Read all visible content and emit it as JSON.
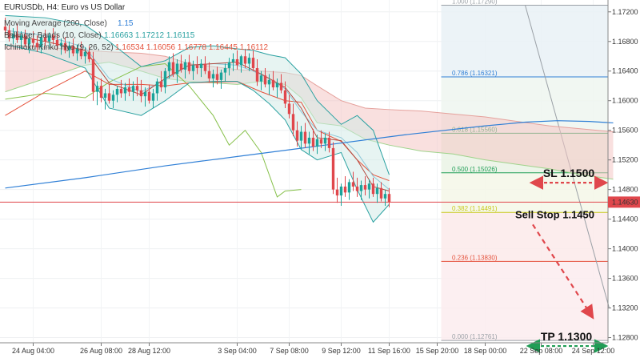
{
  "chart_data": {
    "type": "candlestick",
    "title": "EURUSDb, H4: Euro vs US Dollar",
    "indicators": [
      {
        "label": "Moving Average (200, Close)",
        "values": "1.15",
        "color": "#2f7fd6"
      },
      {
        "label": "Bollinger Bands (10, Close)",
        "values": "1.16663  1.17212  1.16115",
        "color": "#2aa1a1"
      },
      {
        "label": "Ichimoku Kinko Hyo (9, 26, 52)",
        "values": "1.16534  1.16056  1.16778  1.16445  1.16112",
        "color": "#e5533d"
      }
    ],
    "x_tick_labels": [
      "24 Aug 04:00",
      "26 Aug 08:00",
      "28 Aug 12:00",
      "3 Sep 04:00",
      "7 Sep 08:00",
      "9 Sep 12:00",
      "11 Sep 16:00",
      "15 Sep 20:00",
      "18 Sep 00:00",
      "22 Sep 08:00",
      "24 Sep 12:00"
    ],
    "y_tick_labels": [
      "1.17200",
      "1.16800",
      "1.16400",
      "1.16000",
      "1.15600",
      "1.15200",
      "1.14800",
      "1.14400",
      "1.14000",
      "1.13600",
      "1.13200",
      "1.12800"
    ],
    "ylim": [
      1.1273,
      1.1736
    ],
    "current_price": "1.14630",
    "candles": [
      [
        1.17,
        1.1712,
        1.1688,
        1.1695
      ],
      [
        1.1695,
        1.1702,
        1.168,
        1.1684
      ],
      [
        1.1684,
        1.1698,
        1.1676,
        1.169
      ],
      [
        1.169,
        1.1704,
        1.1678,
        1.1682
      ],
      [
        1.1682,
        1.1694,
        1.167,
        1.1688
      ],
      [
        1.1688,
        1.1696,
        1.1672,
        1.1676
      ],
      [
        1.1676,
        1.169,
        1.1664,
        1.1684
      ],
      [
        1.1684,
        1.1694,
        1.1672,
        1.1678
      ],
      [
        1.1678,
        1.1688,
        1.1666,
        1.1672
      ],
      [
        1.1672,
        1.169,
        1.1664,
        1.1686
      ],
      [
        1.1686,
        1.1696,
        1.1674,
        1.168
      ],
      [
        1.168,
        1.1692,
        1.167,
        1.1688
      ],
      [
        1.1688,
        1.1698,
        1.1676,
        1.1682
      ],
      [
        1.1682,
        1.169,
        1.1668,
        1.1674
      ],
      [
        1.1674,
        1.1684,
        1.1662,
        1.1678
      ],
      [
        1.1678,
        1.1686,
        1.1664,
        1.1668
      ],
      [
        1.1668,
        1.168,
        1.1658,
        1.1674
      ],
      [
        1.1674,
        1.1684,
        1.166,
        1.1664
      ],
      [
        1.1664,
        1.1676,
        1.1654,
        1.167
      ],
      [
        1.167,
        1.168,
        1.1656,
        1.166
      ],
      [
        1.166,
        1.1672,
        1.165,
        1.1666
      ],
      [
        1.1666,
        1.1674,
        1.1652,
        1.1656
      ],
      [
        1.1656,
        1.1666,
        1.16,
        1.1612
      ],
      [
        1.1612,
        1.1626,
        1.1594,
        1.162
      ],
      [
        1.162,
        1.163,
        1.1598,
        1.1604
      ],
      [
        1.1604,
        1.1616,
        1.1588,
        1.161
      ],
      [
        1.161,
        1.1622,
        1.1596,
        1.16
      ],
      [
        1.16,
        1.1614,
        1.159,
        1.1608
      ],
      [
        1.1608,
        1.162,
        1.1598,
        1.1616
      ],
      [
        1.1616,
        1.1628,
        1.1604,
        1.161
      ],
      [
        1.161,
        1.1624,
        1.16,
        1.1618
      ],
      [
        1.1618,
        1.163,
        1.1606,
        1.1612
      ],
      [
        1.1612,
        1.1626,
        1.16,
        1.162
      ],
      [
        1.162,
        1.1632,
        1.1606,
        1.1614
      ],
      [
        1.1614,
        1.1628,
        1.1598,
        1.1606
      ],
      [
        1.1606,
        1.1618,
        1.1592,
        1.1612
      ],
      [
        1.1612,
        1.1622,
        1.1596,
        1.16
      ],
      [
        1.16,
        1.1616,
        1.159,
        1.161
      ],
      [
        1.161,
        1.163,
        1.16,
        1.1626
      ],
      [
        1.1626,
        1.164,
        1.1612,
        1.1618
      ],
      [
        1.1618,
        1.1644,
        1.161,
        1.164
      ],
      [
        1.164,
        1.166,
        1.163,
        1.1652
      ],
      [
        1.1652,
        1.1664,
        1.1632,
        1.1636
      ],
      [
        1.1636,
        1.1656,
        1.1624,
        1.165
      ],
      [
        1.165,
        1.1662,
        1.1638,
        1.1642
      ],
      [
        1.1642,
        1.1656,
        1.163,
        1.1652
      ],
      [
        1.1652,
        1.1662,
        1.1636,
        1.164
      ],
      [
        1.164,
        1.1654,
        1.1628,
        1.1648
      ],
      [
        1.1648,
        1.166,
        1.1636,
        1.1644
      ],
      [
        1.1644,
        1.1656,
        1.1632,
        1.165
      ],
      [
        1.165,
        1.166,
        1.1636,
        1.164
      ],
      [
        1.164,
        1.1652,
        1.1624,
        1.163
      ],
      [
        1.163,
        1.1642,
        1.1618,
        1.1636
      ],
      [
        1.1636,
        1.1646,
        1.1622,
        1.1628
      ],
      [
        1.1628,
        1.1642,
        1.1616,
        1.1638
      ],
      [
        1.1638,
        1.165,
        1.1626,
        1.1644
      ],
      [
        1.1644,
        1.1658,
        1.1634,
        1.1652
      ],
      [
        1.1652,
        1.1664,
        1.164,
        1.1656
      ],
      [
        1.1656,
        1.1668,
        1.1642,
        1.1648
      ],
      [
        1.1648,
        1.1662,
        1.1638,
        1.166
      ],
      [
        1.166,
        1.167,
        1.1644,
        1.165
      ],
      [
        1.165,
        1.1664,
        1.164,
        1.1658
      ],
      [
        1.1658,
        1.1668,
        1.164,
        1.1644
      ],
      [
        1.1644,
        1.1656,
        1.162,
        1.1626
      ],
      [
        1.1626,
        1.164,
        1.1614,
        1.1634
      ],
      [
        1.1634,
        1.1644,
        1.1618,
        1.1622
      ],
      [
        1.1622,
        1.1636,
        1.1608,
        1.1628
      ],
      [
        1.1628,
        1.164,
        1.1614,
        1.1618
      ],
      [
        1.1618,
        1.163,
        1.1604,
        1.1624
      ],
      [
        1.1624,
        1.1636,
        1.161,
        1.1614
      ],
      [
        1.1614,
        1.1626,
        1.159,
        1.1596
      ],
      [
        1.1596,
        1.1608,
        1.1576,
        1.1582
      ],
      [
        1.1582,
        1.1596,
        1.1552,
        1.156
      ],
      [
        1.156,
        1.1572,
        1.1538,
        1.1546
      ],
      [
        1.1546,
        1.1566,
        1.1534,
        1.1558
      ],
      [
        1.1558,
        1.157,
        1.1536,
        1.1542
      ],
      [
        1.1542,
        1.1558,
        1.1528,
        1.155
      ],
      [
        1.155,
        1.1562,
        1.1532,
        1.1538
      ],
      [
        1.1538,
        1.1554,
        1.1528,
        1.1548
      ],
      [
        1.1548,
        1.156,
        1.1536,
        1.1542
      ],
      [
        1.1542,
        1.1556,
        1.1532,
        1.155
      ],
      [
        1.155,
        1.1558,
        1.153,
        1.1536
      ],
      [
        1.1536,
        1.1544,
        1.1474,
        1.148
      ],
      [
        1.148,
        1.1496,
        1.1462,
        1.1472
      ],
      [
        1.1472,
        1.1488,
        1.1458,
        1.1484
      ],
      [
        1.1484,
        1.1498,
        1.147,
        1.1476
      ],
      [
        1.1476,
        1.1494,
        1.1466,
        1.149
      ],
      [
        1.149,
        1.1504,
        1.1478,
        1.1484
      ],
      [
        1.1484,
        1.1496,
        1.147,
        1.1478
      ],
      [
        1.1478,
        1.1492,
        1.1466,
        1.1486
      ],
      [
        1.1486,
        1.1498,
        1.1472,
        1.148
      ],
      [
        1.148,
        1.1494,
        1.1468,
        1.1488
      ],
      [
        1.1488,
        1.1496,
        1.147,
        1.1474
      ],
      [
        1.1474,
        1.1488,
        1.1462,
        1.1482
      ],
      [
        1.1482,
        1.149,
        1.1464,
        1.1468
      ],
      [
        1.1468,
        1.148,
        1.1458,
        1.1474
      ],
      [
        1.1474,
        1.1482,
        1.1456,
        1.1463
      ]
    ],
    "ma200": [
      [
        0,
        1.1482
      ],
      [
        20,
        1.1496
      ],
      [
        40,
        1.1512
      ],
      [
        60,
        1.1526
      ],
      [
        80,
        1.154
      ],
      [
        100,
        1.1554
      ],
      [
        120,
        1.1566
      ],
      [
        130,
        1.1571
      ],
      [
        138,
        1.1573
      ],
      [
        146,
        1.1572
      ],
      [
        152,
        1.157
      ]
    ],
    "bb_mid": [
      [
        0,
        1.1695
      ],
      [
        10,
        1.1688
      ],
      [
        20,
        1.1672
      ],
      [
        26,
        1.163
      ],
      [
        34,
        1.1612
      ],
      [
        40,
        1.1628
      ],
      [
        46,
        1.1648
      ],
      [
        52,
        1.165
      ],
      [
        58,
        1.1648
      ],
      [
        62,
        1.164
      ],
      [
        66,
        1.163
      ],
      [
        70,
        1.1616
      ],
      [
        74,
        1.1585
      ],
      [
        78,
        1.156
      ],
      [
        84,
        1.155
      ],
      [
        88,
        1.153
      ],
      [
        92,
        1.1498
      ],
      [
        96,
        1.148
      ]
    ],
    "bb_upper": [
      [
        0,
        1.1715
      ],
      [
        10,
        1.1712
      ],
      [
        20,
        1.1702
      ],
      [
        26,
        1.168
      ],
      [
        34,
        1.1646
      ],
      [
        40,
        1.1654
      ],
      [
        46,
        1.1672
      ],
      [
        52,
        1.1674
      ],
      [
        58,
        1.167
      ],
      [
        62,
        1.1668
      ],
      [
        66,
        1.1662
      ],
      [
        70,
        1.1658
      ],
      [
        74,
        1.1636
      ],
      [
        78,
        1.16
      ],
      [
        84,
        1.1568
      ],
      [
        88,
        1.158
      ],
      [
        92,
        1.156
      ],
      [
        96,
        1.15
      ]
    ],
    "bb_lower": [
      [
        0,
        1.1676
      ],
      [
        10,
        1.1664
      ],
      [
        20,
        1.1644
      ],
      [
        26,
        1.159
      ],
      [
        34,
        1.158
      ],
      [
        40,
        1.16
      ],
      [
        46,
        1.1624
      ],
      [
        52,
        1.1626
      ],
      [
        58,
        1.1626
      ],
      [
        62,
        1.1614
      ],
      [
        66,
        1.1596
      ],
      [
        70,
        1.1574
      ],
      [
        74,
        1.1534
      ],
      [
        78,
        1.152
      ],
      [
        84,
        1.153
      ],
      [
        88,
        1.148
      ],
      [
        92,
        1.1436
      ],
      [
        96,
        1.146
      ]
    ],
    "tenkan": [
      [
        0,
        1.169
      ],
      [
        10,
        1.168
      ],
      [
        20,
        1.1668
      ],
      [
        26,
        1.1624
      ],
      [
        34,
        1.1608
      ],
      [
        40,
        1.163
      ],
      [
        46,
        1.1648
      ],
      [
        52,
        1.165
      ],
      [
        58,
        1.1652
      ],
      [
        64,
        1.1636
      ],
      [
        70,
        1.1618
      ],
      [
        74,
        1.159
      ],
      [
        78,
        1.155
      ],
      [
        84,
        1.1546
      ],
      [
        88,
        1.152
      ],
      [
        92,
        1.1484
      ],
      [
        96,
        1.1478
      ]
    ],
    "kijun": [
      [
        0,
        1.158
      ],
      [
        10,
        1.1612
      ],
      [
        20,
        1.164
      ],
      [
        26,
        1.1622
      ],
      [
        34,
        1.1622
      ],
      [
        40,
        1.162
      ],
      [
        46,
        1.1624
      ],
      [
        52,
        1.1625
      ],
      [
        58,
        1.1626
      ],
      [
        64,
        1.1612
      ],
      [
        70,
        1.16
      ],
      [
        74,
        1.1598
      ],
      [
        78,
        1.156
      ],
      [
        84,
        1.1545
      ],
      [
        88,
        1.152
      ],
      [
        92,
        1.15
      ],
      [
        96,
        1.1492
      ]
    ],
    "chikou": [
      [
        0,
        1.1602
      ],
      [
        10,
        1.161
      ],
      [
        20,
        1.1604
      ],
      [
        26,
        1.1625
      ],
      [
        34,
        1.1646
      ],
      [
        40,
        1.165
      ],
      [
        46,
        1.162
      ],
      [
        52,
        1.158
      ],
      [
        56,
        1.154
      ],
      [
        60,
        1.156
      ],
      [
        64,
        1.153
      ],
      [
        68,
        1.147
      ],
      [
        70,
        1.1478
      ],
      [
        74,
        1.148
      ]
    ],
    "kumo_top": [
      [
        0,
        1.1676
      ],
      [
        10,
        1.1672
      ],
      [
        20,
        1.1668
      ],
      [
        26,
        1.1666
      ],
      [
        34,
        1.1664
      ],
      [
        40,
        1.166
      ],
      [
        46,
        1.165
      ],
      [
        52,
        1.1646
      ],
      [
        58,
        1.1642
      ],
      [
        64,
        1.164
      ],
      [
        70,
        1.1638
      ],
      [
        74,
        1.1634
      ],
      [
        78,
        1.162
      ],
      [
        84,
        1.16
      ],
      [
        90,
        1.159
      ],
      [
        96,
        1.1588
      ],
      [
        104,
        1.1586
      ],
      [
        112,
        1.1582
      ],
      [
        120,
        1.1578
      ],
      [
        128,
        1.1572
      ],
      [
        136,
        1.1566
      ],
      [
        144,
        1.1562
      ],
      [
        152,
        1.1558
      ]
    ],
    "kumo_bottom": [
      [
        0,
        1.1612
      ],
      [
        10,
        1.163
      ],
      [
        20,
        1.1648
      ],
      [
        26,
        1.1652
      ],
      [
        34,
        1.164
      ],
      [
        40,
        1.163
      ],
      [
        46,
        1.1626
      ],
      [
        52,
        1.1624
      ],
      [
        58,
        1.1622
      ],
      [
        64,
        1.1626
      ],
      [
        70,
        1.1622
      ],
      [
        74,
        1.1604
      ],
      [
        78,
        1.157
      ],
      [
        84,
        1.1566
      ],
      [
        90,
        1.1548
      ],
      [
        96,
        1.154
      ],
      [
        104,
        1.1532
      ],
      [
        112,
        1.1528
      ],
      [
        120,
        1.152
      ],
      [
        128,
        1.1514
      ],
      [
        136,
        1.1508
      ],
      [
        144,
        1.15
      ],
      [
        152,
        1.1494
      ]
    ],
    "fibonacci": {
      "start": 1.1729,
      "end": 1.12761,
      "levels": [
        {
          "ratio": "1.000",
          "price": "1.17290",
          "color": "#9aa0a6"
        },
        {
          "ratio": "0.786",
          "price": "1.16321",
          "color": "#2f7fd6"
        },
        {
          "ratio": "0.618",
          "price": "1.15560",
          "color": "#1f9d55"
        },
        {
          "ratio": "0.500",
          "price": "1.15026",
          "color": "#1f9d55"
        },
        {
          "ratio": "0.382",
          "price": "1.14491",
          "color": "#c7c91a"
        },
        {
          "ratio": "0.236",
          "price": "1.13830",
          "color": "#e5533d"
        },
        {
          "ratio": "0.000",
          "price": "1.12761",
          "color": "#9aa0a6"
        }
      ]
    },
    "annotations": {
      "sl": {
        "text": "SL 1.1500",
        "price": 1.15
      },
      "sell_stop": {
        "text": "Sell Stop 1.1450",
        "price": 1.145
      },
      "tp": {
        "text": "TP 1.1300",
        "price": 1.13
      }
    },
    "colors": {
      "bull": "#1aa39a",
      "bear": "#e0474c",
      "ma200": "#2f7fd6",
      "bb": "#2aa1a1",
      "tenkan": "#e5533d",
      "kijun": "#e5533d",
      "chikou": "#86c04a",
      "price_line": "#e0474c",
      "arrow": "#e0474c",
      "tp_arrow": "#1f9d55"
    }
  }
}
